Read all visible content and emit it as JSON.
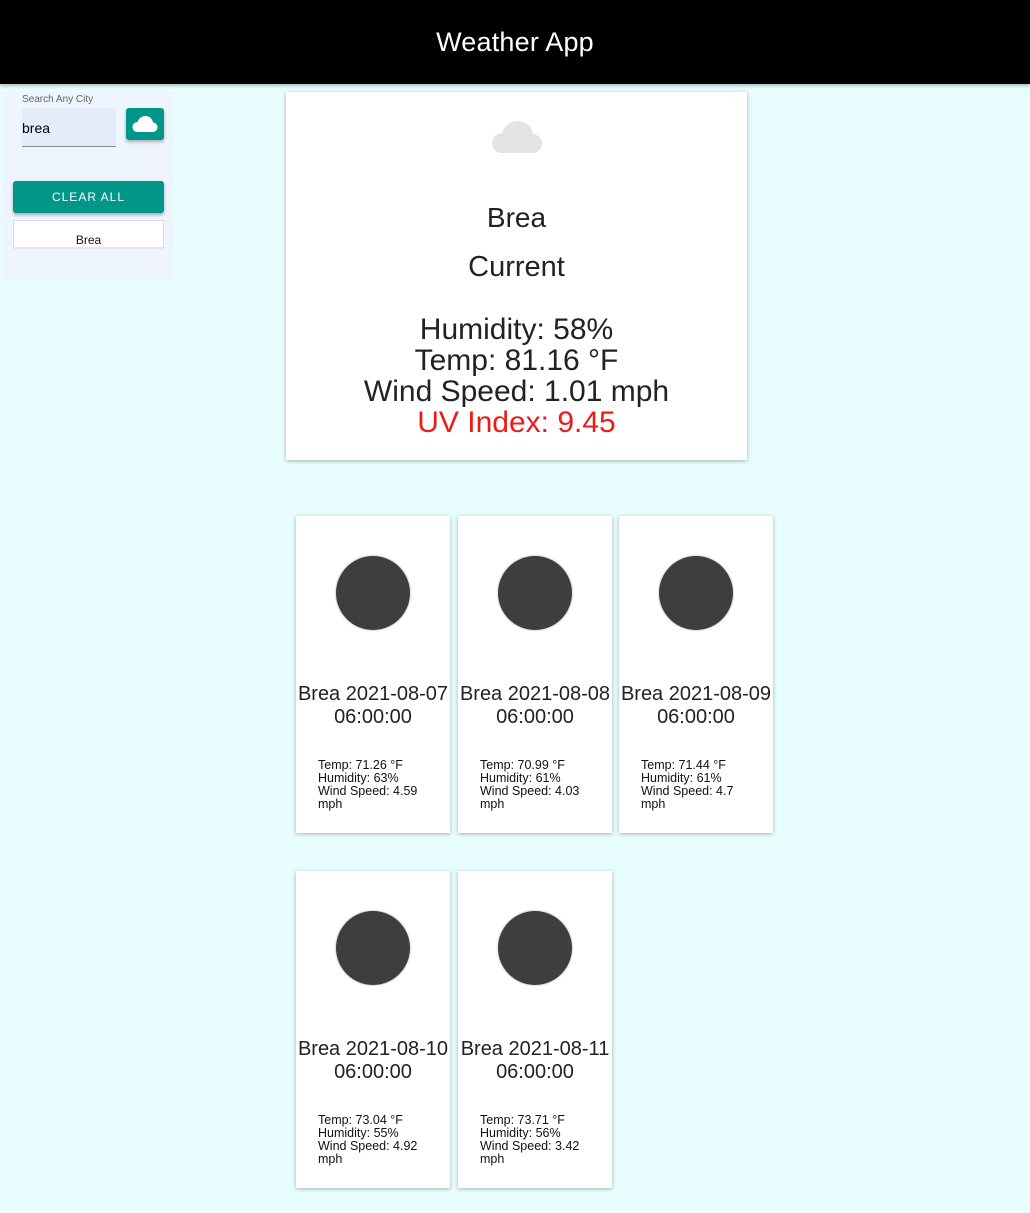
{
  "header": {
    "title": "Weather App"
  },
  "sidebar": {
    "search_label": "Search Any City",
    "search_value": "brea",
    "search_icon": "cloud-icon",
    "clear_label": "CLEAR ALL",
    "history": [
      "Brea"
    ]
  },
  "current": {
    "city": "Brea",
    "label": "Current",
    "humidity": "Humidity: 58%",
    "temp": "Temp: 81.16 °F",
    "wind": "Wind Speed: 1.01 mph",
    "uv": "UV Index: 9.45",
    "icon": "cloud-icon"
  },
  "forecast": [
    {
      "title": "Brea 2021-08-07 06:00:00",
      "temp": "Temp: 71.26 °F",
      "humidity": "Humidity: 63%",
      "wind": "Wind Speed: 4.59 mph"
    },
    {
      "title": "Brea 2021-08-08 06:00:00",
      "temp": "Temp: 70.99 °F",
      "humidity": "Humidity: 61%",
      "wind": "Wind Speed: 4.03 mph"
    },
    {
      "title": "Brea 2021-08-09 06:00:00",
      "temp": "Temp: 71.44 °F",
      "humidity": "Humidity: 61%",
      "wind": "Wind Speed: 4.7 mph"
    },
    {
      "title": "Brea 2021-08-10 06:00:00",
      "temp": "Temp: 73.04 °F",
      "humidity": "Humidity: 55%",
      "wind": "Wind Speed: 4.92 mph"
    },
    {
      "title": "Brea 2021-08-11 06:00:00",
      "temp": "Temp: 73.71 °F",
      "humidity": "Humidity: 56%",
      "wind": "Wind Speed: 3.42 mph"
    }
  ],
  "colors": {
    "accent": "#009688",
    "uv_alert": "#ee1a1a",
    "page_bg": "#e8fdfd",
    "header_bg": "#000000"
  }
}
